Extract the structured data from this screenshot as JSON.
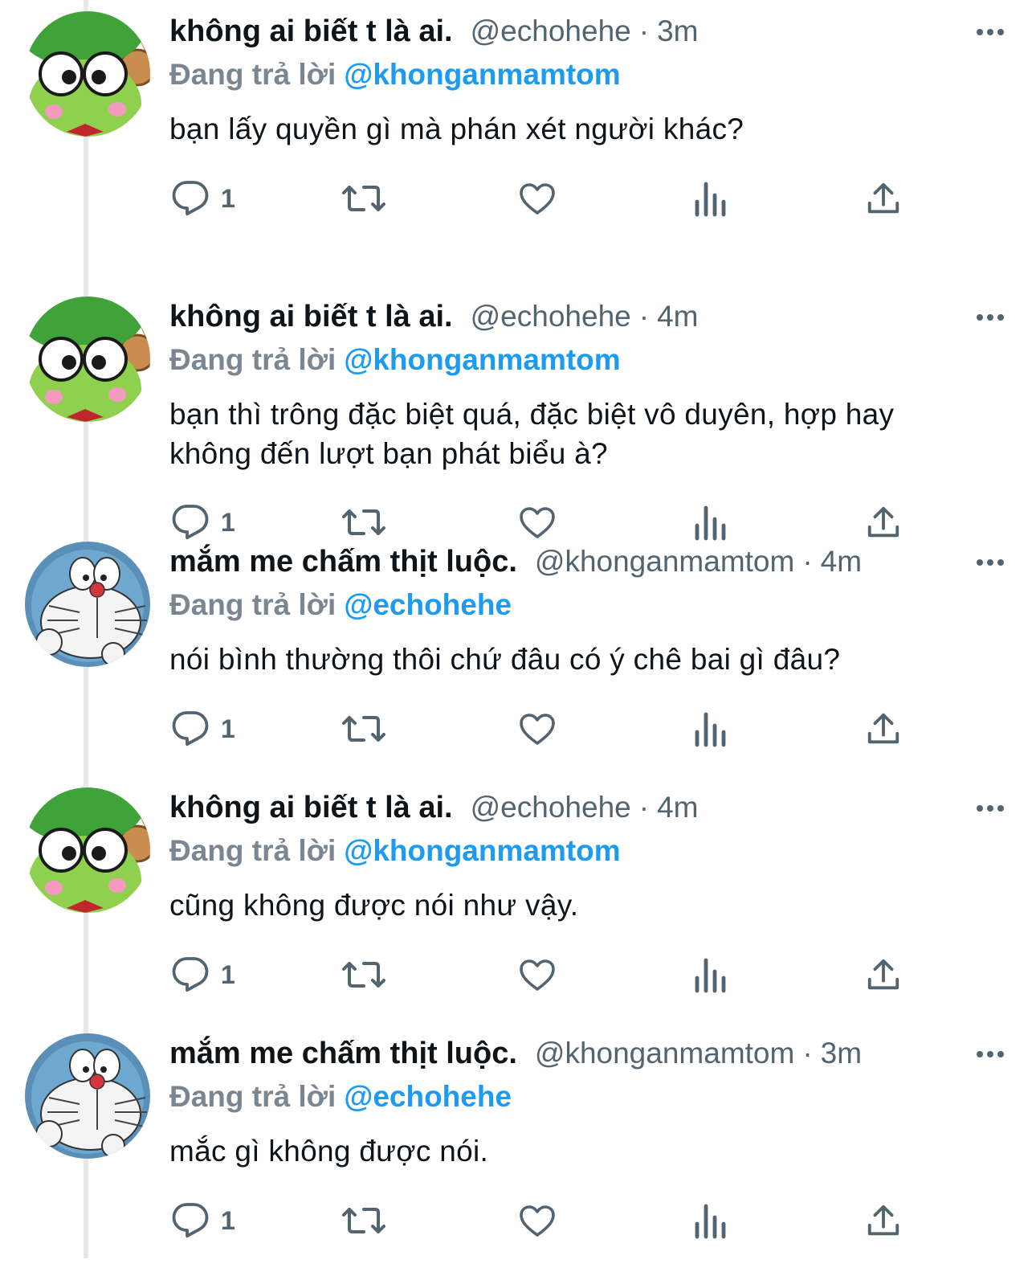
{
  "colors": {
    "link": "#1d9bf0",
    "secondary_text": "#536471",
    "primary_text": "#0f1419",
    "thread_line": "#e6e9ec"
  },
  "tweets": [
    {
      "display_name": "không ai biết t là ai.",
      "handle": "@echohehe",
      "separator": "·",
      "time": "4m",
      "reply_prefix": "Đang trả lời",
      "reply_to": "@khonganmamtom",
      "text": "bạn thì trông đặc biệt quá, đặc biệt vô duyên, hợp hay không đến lượt bạn phát biểu à?",
      "reply_count": "1",
      "avatar": "frog-avatar"
    },
    {
      "display_name": "mắm me chấm thịt luộc.",
      "handle": "@khonganmamtom",
      "separator": "·",
      "time": "4m",
      "reply_prefix": "Đang trả lời",
      "reply_to": "@echohehe",
      "text": "nói bình thường thôi chứ đâu có ý chê bai gì đâu?",
      "reply_count": "1",
      "avatar": "robot-cat-avatar"
    },
    {
      "display_name": "không ai biết t là ai.",
      "handle": "@echohehe",
      "separator": "·",
      "time": "4m",
      "reply_prefix": "Đang trả lời",
      "reply_to": "@khonganmamtom",
      "text": "cũng không được nói như vậy.",
      "reply_count": "1",
      "avatar": "frog-avatar"
    },
    {
      "display_name": "mắm me chấm thịt luộc.",
      "handle": "@khonganmamtom",
      "separator": "·",
      "time": "3m",
      "reply_prefix": "Đang trả lời",
      "reply_to": "@echohehe",
      "text": "mắc gì không được nói.",
      "reply_count": "1",
      "avatar": "robot-cat-avatar"
    },
    {
      "display_name": "không ai biết t là ai.",
      "handle": "@echohehe",
      "separator": "·",
      "time": "3m",
      "reply_prefix": "Đang trả lời",
      "reply_to": "@khonganmamtom",
      "text": "bạn lấy quyền gì mà phán xét người khác?",
      "reply_count": "1",
      "avatar": "frog-avatar"
    }
  ]
}
